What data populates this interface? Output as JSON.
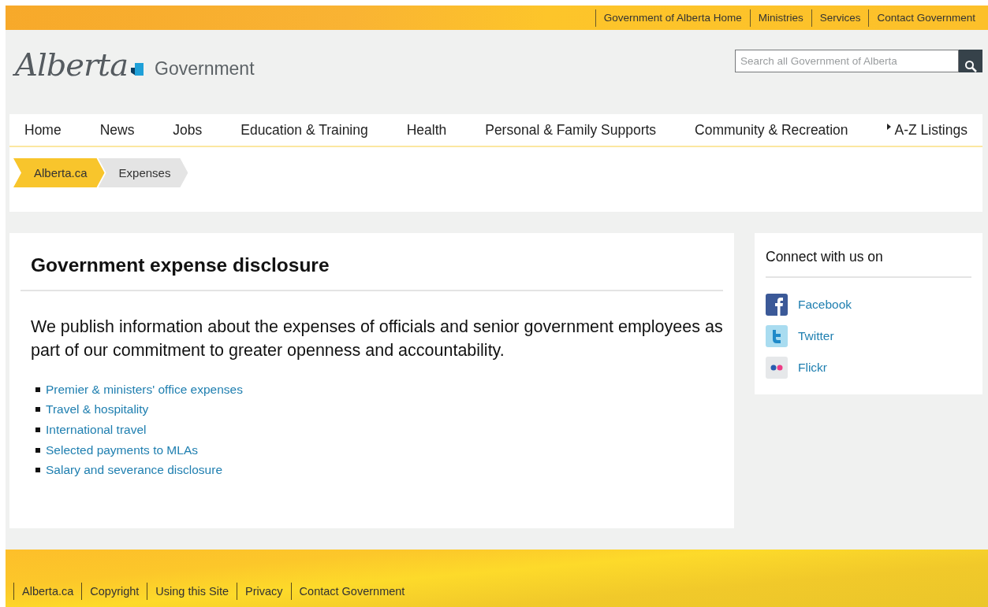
{
  "top_links": [
    "Government of Alberta Home",
    "Ministries",
    "Services",
    "Contact Government"
  ],
  "logo": {
    "script": "Alberta",
    "word": "Government"
  },
  "search": {
    "placeholder": "Search all Government of Alberta"
  },
  "nav": [
    "Home",
    "News",
    "Jobs",
    "Education & Training",
    "Health",
    "Personal & Family Supports",
    "Community & Recreation"
  ],
  "az_link": "A-Z Listings",
  "breadcrumb": [
    {
      "label": "Alberta.ca",
      "selected": false
    },
    {
      "label": "Expenses",
      "selected": true
    }
  ],
  "main": {
    "title": "Government expense disclosure",
    "intro": "We publish information about the expenses of officials and senior government employees as part of our commitment to greater openness and accountability.",
    "links": [
      "Premier & ministers' office expenses",
      "Travel & hospitality",
      "International travel",
      "Selected payments to MLAs",
      "Salary and severance disclosure"
    ]
  },
  "sidebar": {
    "title": "Connect with us on",
    "links": [
      {
        "kind": "facebook",
        "label": "Facebook"
      },
      {
        "kind": "twitter",
        "label": "Twitter"
      },
      {
        "kind": "flickr",
        "label": "Flickr"
      }
    ]
  },
  "footer_links": [
    "Alberta.ca",
    "Copyright",
    "Using this Site",
    "Privacy",
    "Contact Government"
  ]
}
